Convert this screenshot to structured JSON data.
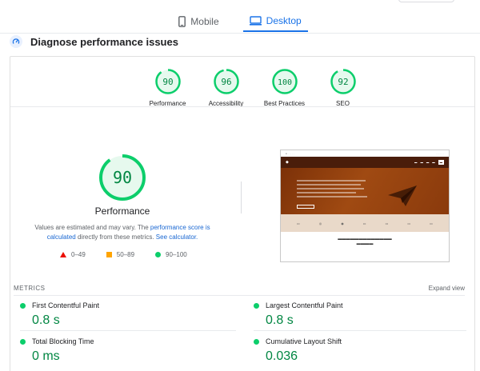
{
  "tabs": [
    {
      "label": "Mobile",
      "icon": "phone-icon",
      "active": false
    },
    {
      "label": "Desktop",
      "icon": "desktop-icon",
      "active": true
    }
  ],
  "section": {
    "title": "Diagnose performance issues",
    "icon": "speedometer-icon"
  },
  "gauges": [
    {
      "label": "Performance",
      "score": "90"
    },
    {
      "label": "Accessibility",
      "score": "96"
    },
    {
      "label": "Best Practices",
      "score": "100"
    },
    {
      "label": "SEO",
      "score": "92"
    }
  ],
  "main_score": {
    "score": "90",
    "title": "Performance"
  },
  "perf_note": {
    "text1": "Values are estimated and may vary. The ",
    "link1": "performance score is calculated",
    "text2": " directly from these metrics. ",
    "link2": "See calculator."
  },
  "legend": [
    {
      "label": "0–49",
      "shape": "triangle",
      "color": "#eb0f00"
    },
    {
      "label": "50–89",
      "shape": "square",
      "color": "#ffa400"
    },
    {
      "label": "90–100",
      "shape": "circle",
      "color": "#0cce6b"
    }
  ],
  "metrics": {
    "label": "METRICS",
    "expand": "Expand view",
    "items": [
      {
        "name": "First Contentful Paint",
        "value": "0.8 s"
      },
      {
        "name": "Largest Contentful Paint",
        "value": "0.8 s"
      },
      {
        "name": "Total Blocking Time",
        "value": "0 ms"
      },
      {
        "name": "Cumulative Layout Shift",
        "value": "0.036"
      }
    ]
  },
  "colors": {
    "pass": "#0cce6b",
    "pass_text": "#018642",
    "accent": "#1a73e8"
  }
}
